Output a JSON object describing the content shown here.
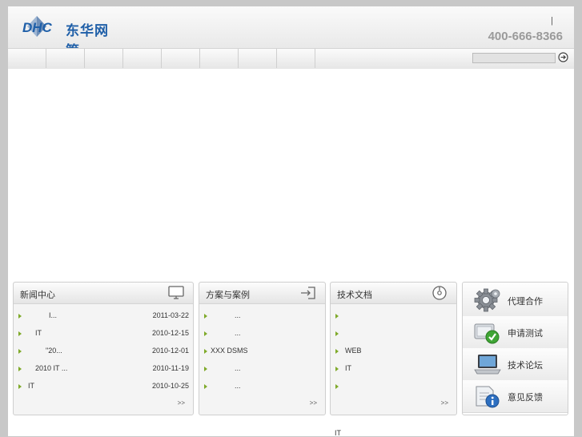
{
  "brand": {
    "logo_text": "DHC",
    "name": "东华网管",
    "separator": "|",
    "hotline": "400-666-8366"
  },
  "navbar": {
    "items": [
      "",
      "",
      "",
      "",
      "",
      "",
      "",
      ""
    ],
    "search_placeholder": ""
  },
  "panels": [
    {
      "id": "news",
      "title": "新闻中心",
      "icon": "monitor-icon",
      "rows": [
        {
          "title": "I...",
          "date": "2011-03-22"
        },
        {
          "title": "IT",
          "date": "2010-12-15"
        },
        {
          "title": "\"20...",
          "date": "2010-12-01"
        },
        {
          "title": "2010  IT ...",
          "date": "2010-11-19"
        },
        {
          "title": "IT",
          "date": "2010-10-25"
        }
      ],
      "more": ">>"
    },
    {
      "id": "solutions",
      "title": "方案与案例",
      "icon": "import-icon",
      "rows": [
        {
          "title": "...",
          "date": ""
        },
        {
          "title": "...",
          "date": ""
        },
        {
          "title": "XXX   DSMS",
          "date": ""
        },
        {
          "title": "...",
          "date": ""
        },
        {
          "title": "...",
          "date": ""
        }
      ],
      "more": ">>"
    },
    {
      "id": "docs",
      "title": "技术文档",
      "icon": "disc-icon",
      "rows": [
        {
          "title": "",
          "date": ""
        },
        {
          "title": "",
          "date": ""
        },
        {
          "title": "WEB",
          "date": ""
        },
        {
          "title": "IT",
          "date": ""
        },
        {
          "title": "",
          "date": ""
        }
      ],
      "more": ">>"
    }
  ],
  "side_links": [
    {
      "label": "代理合作",
      "icon": "gear-icon"
    },
    {
      "label": "申请测试",
      "icon": "check-box-icon"
    },
    {
      "label": "技术论坛",
      "icon": "laptop-icon"
    },
    {
      "label": "意见反馈",
      "icon": "info-feedback-icon"
    }
  ],
  "footer": {
    "text": "IT"
  },
  "colors": {
    "brand_blue": "#1f5fa8",
    "bullet_green": "#7faa2a",
    "hotline_gray": "#9a9a9a"
  }
}
